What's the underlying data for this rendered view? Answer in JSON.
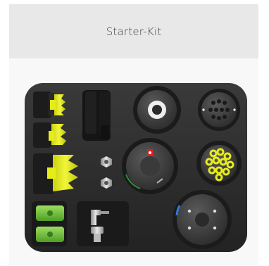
{
  "card": {
    "title": "Starter-Kit"
  },
  "image": {
    "subject": "starter-kit-foam-case",
    "colors": {
      "foam": "#2b2b2b",
      "bellows": "#e6ec1a",
      "green_part": "#7bc843",
      "metal": "#bcbcbc",
      "accent_red": "#e02020",
      "accent_blue": "#2a7bd8"
    }
  }
}
